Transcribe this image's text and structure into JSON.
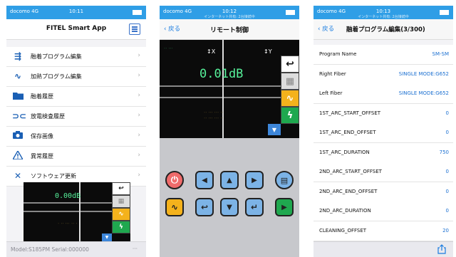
{
  "colors": {
    "statusbar": "#2f9ee6",
    "link": "#1a7ce0",
    "value": "#1a6fd1",
    "db": "#56f19a"
  },
  "status": {
    "carrier": "docomo 4G",
    "time1": "10:11",
    "time2": "10:12",
    "time3": "10:13",
    "sub": "インターネット共有: 2台接続中"
  },
  "home": {
    "title": "FITEL Smart App",
    "menu": [
      {
        "label": "融着プログラム編集",
        "icon": "splice-program-icon"
      },
      {
        "label": "加熱プログラム編集",
        "icon": "heat-program-icon"
      },
      {
        "label": "融着履歴",
        "icon": "folder-icon"
      },
      {
        "label": "放電検査履歴",
        "icon": "arc-check-icon"
      },
      {
        "label": "保存画像",
        "icon": "camera-icon"
      },
      {
        "label": "異常履歴",
        "icon": "warning-icon"
      },
      {
        "label": "ソフトウェア更新",
        "icon": "tools-icon"
      }
    ],
    "preview_loss": "0.00dB",
    "footer": "Model:S185PM Serial:000000",
    "footer_more": "···"
  },
  "remote": {
    "back": "戻る",
    "title": "リモート制御",
    "loss": "0.01dB",
    "axis_x": "X",
    "axis_y": "Y",
    "keys": {
      "return": "↵"
    }
  },
  "program": {
    "back": "戻る",
    "title": "融着プログラム編集(3/300)",
    "rows": [
      {
        "key": "Program Name",
        "value": "SM-SM"
      },
      {
        "key": "Right Fiber",
        "value": "SINGLE MODE:G652"
      },
      {
        "key": "Left Fiber",
        "value": "SINGLE MODE:G652"
      },
      {
        "key": "1ST_ARC_START_OFFSET",
        "value": "0"
      },
      {
        "key": "1ST_ARC_END_OFFSET",
        "value": "0"
      },
      {
        "key": "1ST_ARC_DURATION",
        "value": "750"
      },
      {
        "key": "2ND_ARC_START_OFFSET",
        "value": "0"
      },
      {
        "key": "2ND_ARC_END_OFFSET",
        "value": "0"
      },
      {
        "key": "2ND_ARC_DURATION",
        "value": "0"
      },
      {
        "key": "CLEANING_OFFSET",
        "value": "20"
      }
    ]
  }
}
